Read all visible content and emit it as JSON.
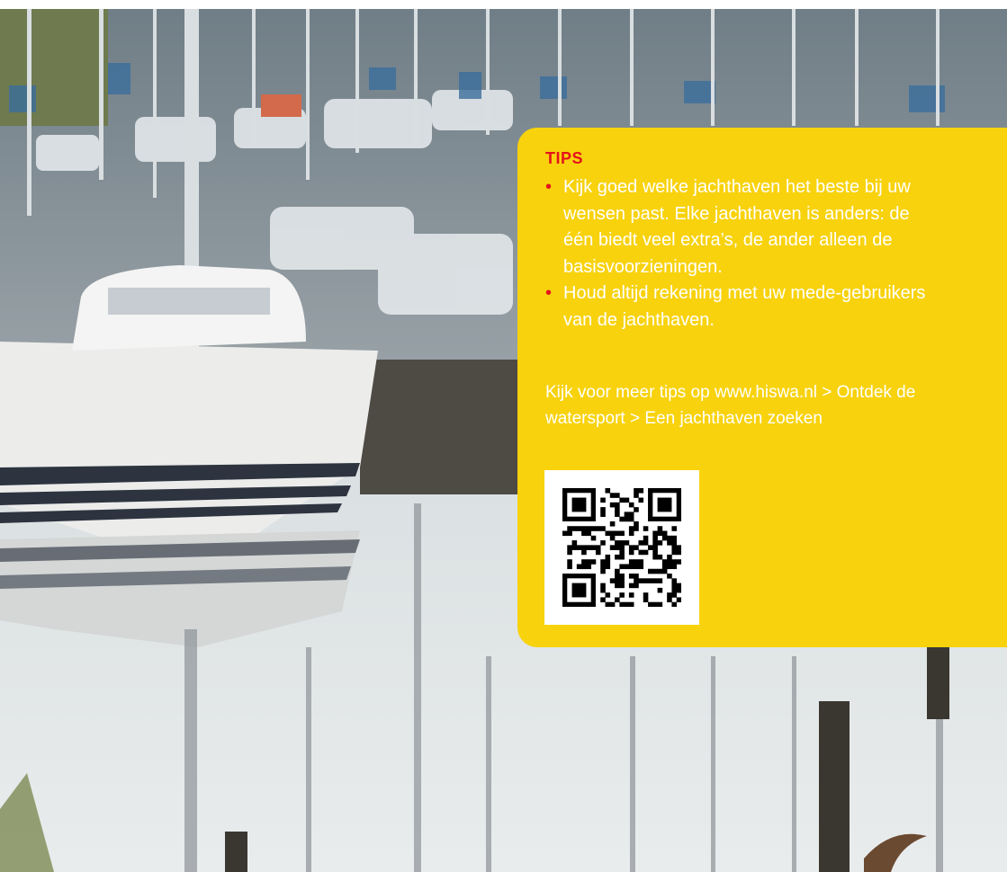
{
  "tips": {
    "heading": "TIPS",
    "items": [
      "Kijk goed welke jachthaven het beste bij uw wensen past. Elke jachthaven is anders: de één biedt veel extra’s, de ander alleen de basisvoorzieningen.",
      "Houd altijd rekening met uw mede-gebruikers van de jachthaven."
    ],
    "more_info": "Kijk voor meer tips op www.hiswa.nl > Ontdek de watersport > Een jachthaven zoeken"
  },
  "colors": {
    "panel": "#f8d20d",
    "heading": "#e4131b",
    "text": "#ffffff"
  },
  "qr": {
    "label": "qr-code"
  }
}
